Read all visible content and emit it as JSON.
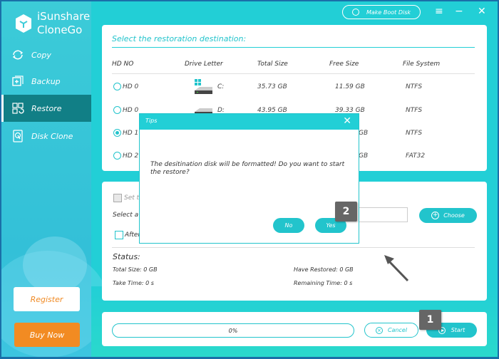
{
  "app": {
    "name_line1": "iSunshare",
    "name_line2": "CloneGo"
  },
  "sidebar": {
    "items": [
      {
        "label": "Copy",
        "icon": "copy-icon",
        "active": false
      },
      {
        "label": "Backup",
        "icon": "backup-icon",
        "active": false
      },
      {
        "label": "Restore",
        "icon": "restore-icon",
        "active": true
      },
      {
        "label": "Disk Clone",
        "icon": "disk-clone-icon",
        "active": false
      }
    ],
    "register_label": "Register",
    "buy_label": "Buy Now"
  },
  "topbar": {
    "make_boot_disk": "Make Boot Disk",
    "menu_icon": "≡",
    "minimize_icon": "−",
    "close_icon": "✕"
  },
  "destination": {
    "title": "Select the restoration destination:",
    "columns": [
      "HD NO",
      "Drive Letter",
      "Total Size",
      "Free Size",
      "File System"
    ],
    "rows": [
      {
        "hd": "HD 0",
        "letter": "C:",
        "total": "35.73 GB",
        "free": "11.59 GB",
        "fs": "NTFS",
        "selected": false,
        "windows": true
      },
      {
        "hd": "HD 0",
        "letter": "D:",
        "total": "43.95 GB",
        "free": "39.33 GB",
        "fs": "NTFS",
        "selected": false,
        "windows": false
      },
      {
        "hd": "HD 1",
        "letter": "",
        "total": "",
        "free": "GB",
        "fs": "NTFS",
        "selected": true,
        "windows": false
      },
      {
        "hd": "HD 2",
        "letter": "",
        "total": "",
        "free": "GB",
        "fs": "FAT32",
        "selected": false,
        "windows": false
      }
    ]
  },
  "options": {
    "set_label": "Set t",
    "select_label": "Select a",
    "after_label": "After",
    "choose_label": "Choose",
    "path_value": ""
  },
  "status": {
    "title": "Status:",
    "total_size": "Total Size: 0 GB",
    "take_time": "Take Time: 0 s",
    "have_restored": "Have Restored: 0 GB",
    "remaining_time": "Remaining Time: 0 s"
  },
  "progress": {
    "percent": 0,
    "label": "0%",
    "cancel_label": "Cancel",
    "start_label": "Start"
  },
  "dialog": {
    "title": "Tips",
    "message": "The desitination disk will be formatted! Do you want to start the restore?",
    "no_label": "No",
    "yes_label": "Yes"
  },
  "annotations": {
    "badge1": "1",
    "badge2": "2"
  }
}
